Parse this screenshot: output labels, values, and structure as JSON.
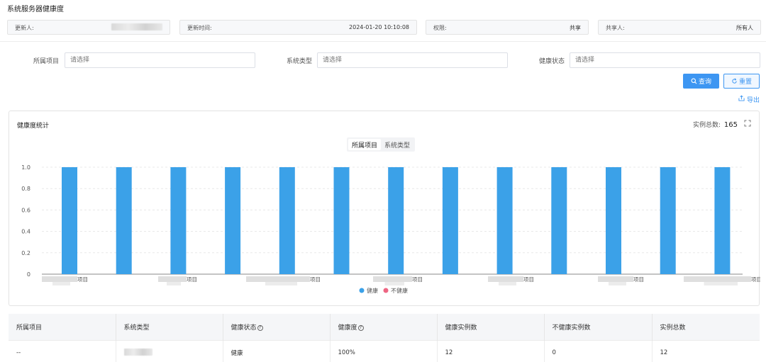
{
  "page": {
    "title": "系统服务器健康度"
  },
  "meta": {
    "updater_label": "更新人:",
    "update_time_label": "更新时间:",
    "update_time": "2024-01-20 10:10:08",
    "permission_label": "权限:",
    "permission": "共享",
    "sharer_label": "共享人:",
    "sharer": "所有人"
  },
  "filters": {
    "project": {
      "label": "所属项目",
      "placeholder": "请选择"
    },
    "system_type": {
      "label": "系统类型",
      "placeholder": "请选择"
    },
    "health_status": {
      "label": "健康状态",
      "placeholder": "请选择"
    }
  },
  "buttons": {
    "query": "查询",
    "reset": "重置",
    "export": "导出"
  },
  "panel": {
    "title": "健康度统计",
    "total_label": "实例总数:",
    "total_value": "165",
    "tabs": [
      "所属项目",
      "系统类型"
    ]
  },
  "chart_data": {
    "type": "bar",
    "ylim": [
      0,
      1.0
    ],
    "yticks": [
      "0",
      "0.2",
      "0.4",
      "0.6",
      "0.8",
      "1.0"
    ],
    "x_label_suffix": "项目",
    "series": [
      {
        "name": "健康",
        "color": "#3ba1e8",
        "values": [
          1,
          1,
          1,
          1,
          1,
          1,
          1,
          1,
          1,
          1,
          1,
          1,
          1
        ]
      },
      {
        "name": "不健康",
        "color": "#ee6683",
        "values": [
          0,
          0,
          0,
          0,
          0,
          0,
          0,
          0,
          0,
          0,
          0,
          0,
          0
        ]
      }
    ],
    "grid": true,
    "legend": "bottom-center"
  },
  "table": {
    "headers": [
      "所属项目",
      "系统类型",
      "健康状态",
      "健康度",
      "健康实例数",
      "不健康实例数",
      "实例总数"
    ],
    "rows": [
      {
        "project": "--",
        "status": "健康",
        "health": "100%",
        "healthy": "12",
        "unhealthy": "0",
        "total": "12"
      }
    ]
  },
  "colors": {
    "accent": "#3d96f2",
    "healthy": "#3ba1e8",
    "unhealthy": "#ee6683"
  }
}
